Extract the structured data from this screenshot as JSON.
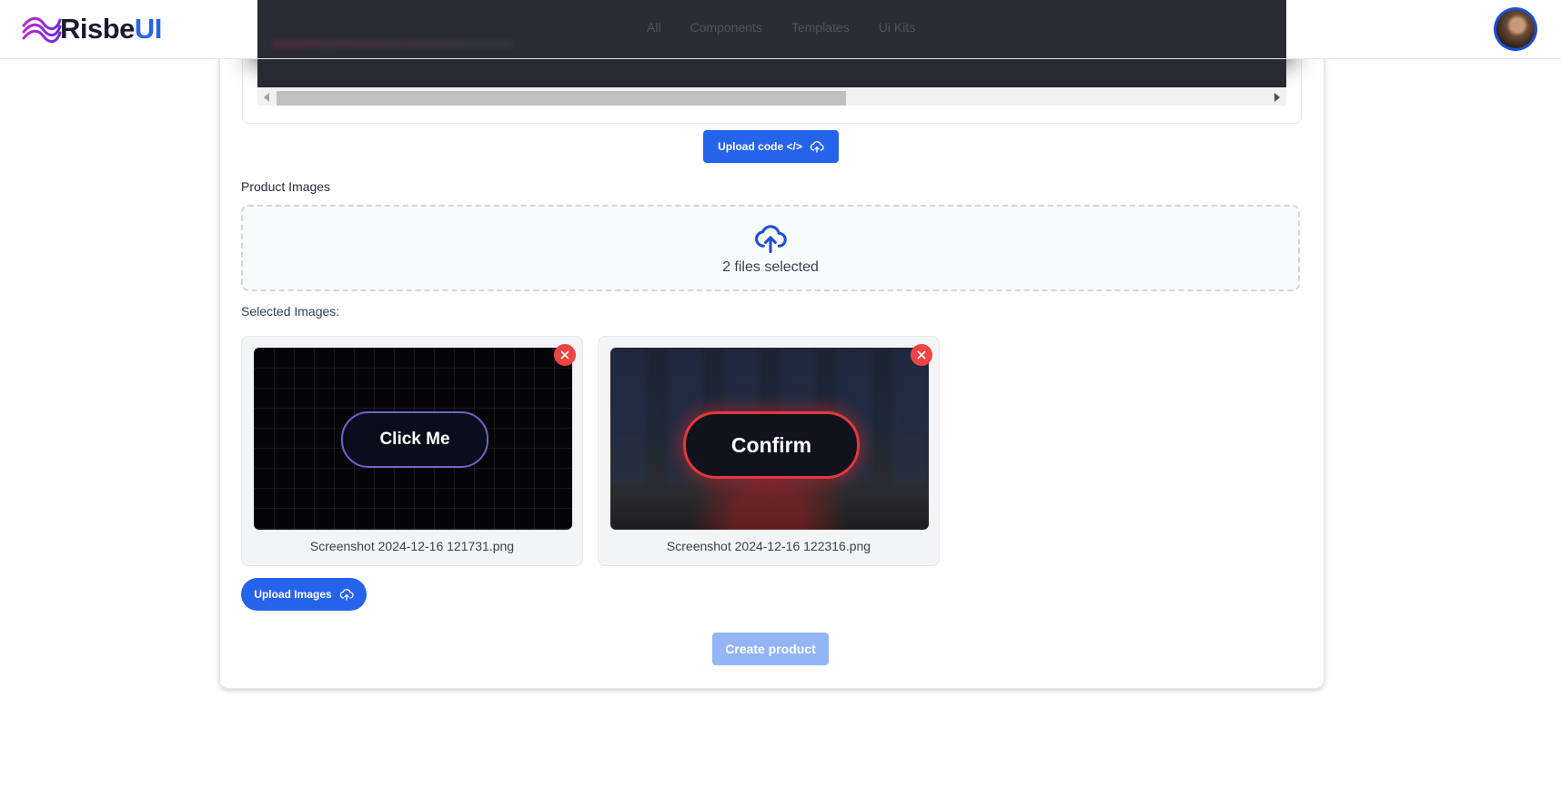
{
  "brand": {
    "name_part1": "Risbe",
    "name_part2": "UI"
  },
  "nav": {
    "items": [
      "All",
      "Components",
      "Templates",
      "Ui Kits"
    ]
  },
  "code_section": {
    "upload_label": "Upload code </>"
  },
  "product_images": {
    "label": "Product Images",
    "dropzone_text": "2 files selected",
    "selected_label": "Selected Images:",
    "images": [
      {
        "caption": "Screenshot 2024-12-16 121731.png",
        "preview_text": "Click Me"
      },
      {
        "caption": "Screenshot 2024-12-16 122316.png",
        "preview_text": "Confirm"
      }
    ],
    "upload_label": "Upload Images"
  },
  "actions": {
    "create_label": "Create product"
  },
  "colors": {
    "primary": "#2563eb",
    "danger": "#ef4444",
    "disabled_primary": "#93b4f5"
  }
}
